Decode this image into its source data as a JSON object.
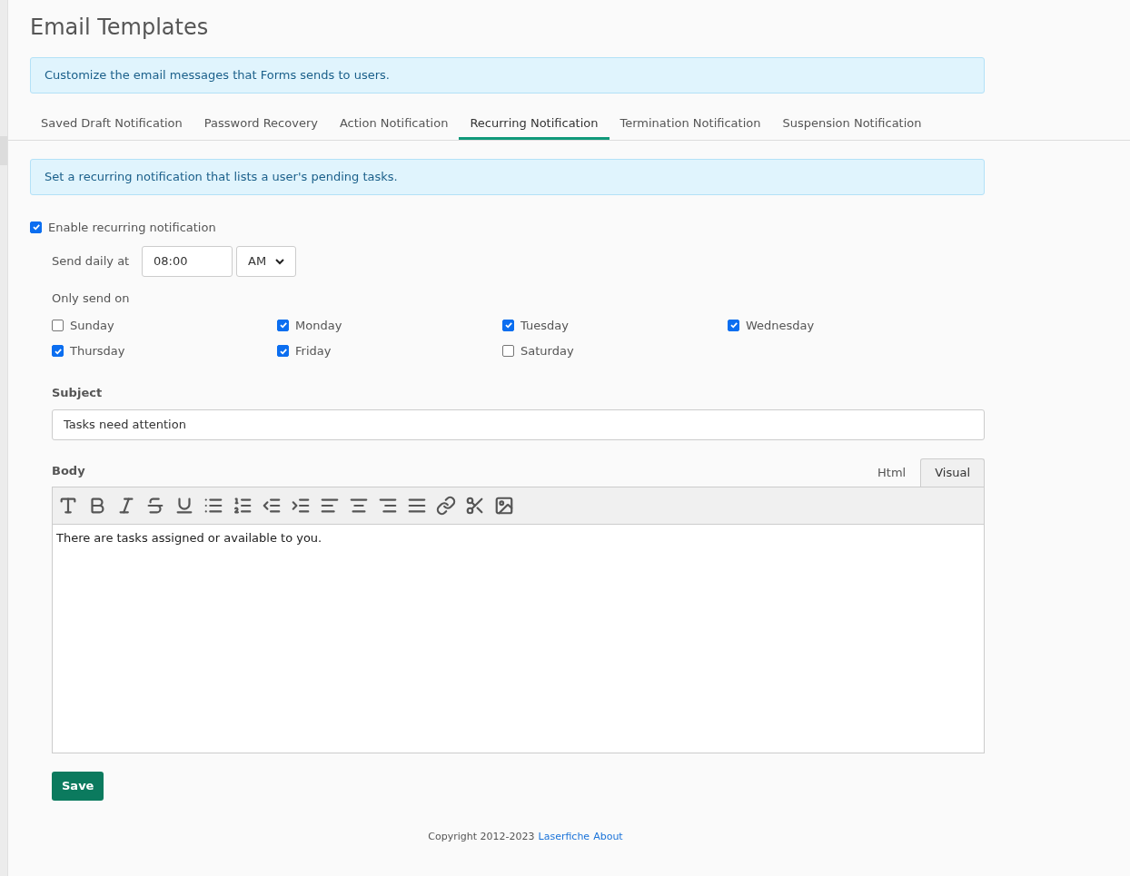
{
  "page": {
    "title": "Email Templates",
    "intro": "Customize the email messages that Forms sends to users."
  },
  "tabs": [
    {
      "label": "Saved Draft Notification",
      "selected": false
    },
    {
      "label": "Password Recovery",
      "selected": false
    },
    {
      "label": "Action Notification",
      "selected": false
    },
    {
      "label": "Recurring Notification",
      "selected": true
    },
    {
      "label": "Termination Notification",
      "selected": false
    },
    {
      "label": "Suspension Notification",
      "selected": false
    }
  ],
  "info": "Set a recurring notification that lists a user's pending tasks.",
  "enable": {
    "label": "Enable recurring notification",
    "checked": true
  },
  "schedule": {
    "label": "Send daily at",
    "time": "08:00",
    "period": "AM"
  },
  "days_label": "Only send on",
  "days": [
    {
      "label": "Sunday",
      "checked": false
    },
    {
      "label": "Monday",
      "checked": true
    },
    {
      "label": "Tuesday",
      "checked": true
    },
    {
      "label": "Wednesday",
      "checked": true
    },
    {
      "label": "Thursday",
      "checked": true
    },
    {
      "label": "Friday",
      "checked": true
    },
    {
      "label": "Saturday",
      "checked": false
    }
  ],
  "subject": {
    "label": "Subject",
    "value": "Tasks need attention"
  },
  "body": {
    "label": "Body",
    "modes": [
      {
        "label": "Html",
        "selected": false
      },
      {
        "label": "Visual",
        "selected": true
      }
    ],
    "text": "There are tasks assigned or available to you."
  },
  "save": "Save",
  "footer": {
    "copyright": "Copyright 2012-2023",
    "links": [
      "Laserfiche",
      "About"
    ]
  }
}
